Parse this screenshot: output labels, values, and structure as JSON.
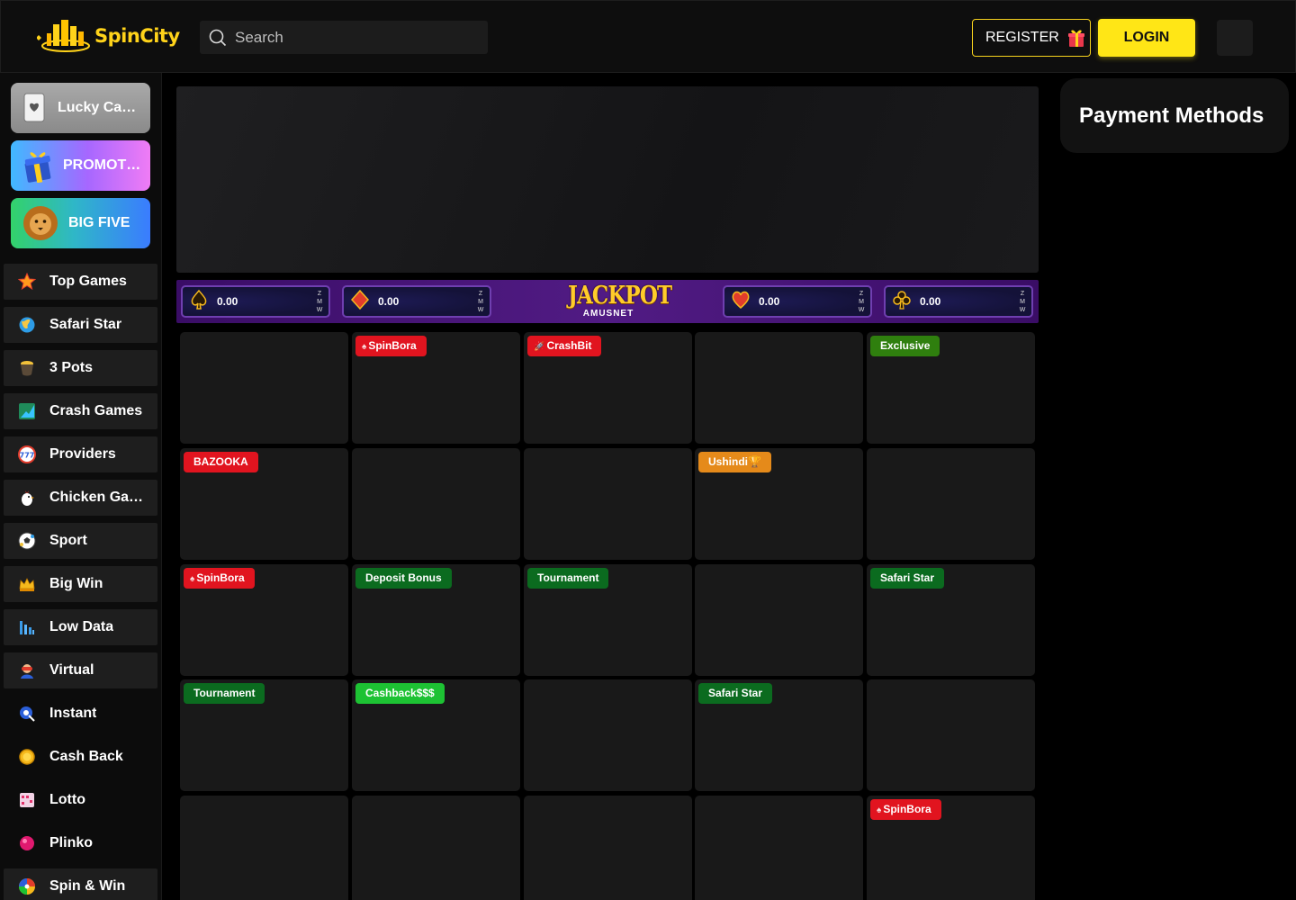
{
  "header": {
    "logo_text": "SpinCity",
    "search_placeholder": "Search",
    "register_label": "REGISTER",
    "login_label": "LOGIN"
  },
  "sidebar": {
    "promos": [
      {
        "label": "Lucky Cards",
        "icon": "card-icon"
      },
      {
        "label": "PROMOTIONS",
        "icon": "gift-icon"
      },
      {
        "label": "BIG FIVE",
        "icon": "lion-icon"
      }
    ],
    "items": [
      {
        "label": "Top Games",
        "icon": "star-icon"
      },
      {
        "label": "Safari Star",
        "icon": "globe-icon"
      },
      {
        "label": "3 Pots",
        "icon": "pot-icon"
      },
      {
        "label": "Crash Games",
        "icon": "crash-chart-icon"
      },
      {
        "label": "Providers",
        "icon": "slot-777-icon"
      },
      {
        "label": "Chicken Games",
        "icon": "chicken-icon"
      },
      {
        "label": "Sport",
        "icon": "soccer-ball-icon"
      },
      {
        "label": "Big Win",
        "icon": "crown-icon"
      },
      {
        "label": "Low Data",
        "icon": "bar-chart-icon"
      },
      {
        "label": "Virtual",
        "icon": "vr-icon"
      },
      {
        "label": "Instant",
        "icon": "instant-icon"
      },
      {
        "label": "Cash Back",
        "icon": "coin-icon"
      },
      {
        "label": "Lotto",
        "icon": "lotto-ticket-icon"
      },
      {
        "label": "Plinko",
        "icon": "plinko-ball-icon"
      },
      {
        "label": "Spin & Win",
        "icon": "wheel-icon"
      }
    ]
  },
  "jackpot": {
    "title": "JACKPOT",
    "provider": "AMUSNET",
    "currency": "ZMW",
    "pots": [
      {
        "suit": "spade",
        "value": "0.00"
      },
      {
        "suit": "diamond",
        "value": "0.00"
      },
      {
        "suit": "heart",
        "value": "0.00"
      },
      {
        "suit": "club",
        "value": "0.00"
      }
    ]
  },
  "tiles": [
    {
      "badge": null
    },
    {
      "badge": "SpinBora",
      "color": "red",
      "icon": "♠"
    },
    {
      "badge": "CrashBit",
      "color": "red",
      "icon": "🚀"
    },
    {
      "badge": null
    },
    {
      "badge": "Exclusive",
      "color": "olive"
    },
    {
      "badge": "BAZOOKA",
      "color": "red"
    },
    {
      "badge": null
    },
    {
      "badge": null
    },
    {
      "badge": "Ushindi🏆",
      "color": "orange"
    },
    {
      "badge": null
    },
    {
      "badge": "SpinBora",
      "color": "red",
      "icon": "♠"
    },
    {
      "badge": "Deposit Bonus",
      "color": "green"
    },
    {
      "badge": "Tournament",
      "color": "green"
    },
    {
      "badge": null
    },
    {
      "badge": "Safari Star",
      "color": "green"
    },
    {
      "badge": "Tournament",
      "color": "green"
    },
    {
      "badge": "Cashback$$$",
      "color": "lime"
    },
    {
      "badge": null
    },
    {
      "badge": "Safari Star",
      "color": "green"
    },
    {
      "badge": null
    },
    {
      "badge": null
    },
    {
      "badge": null
    },
    {
      "badge": null
    },
    {
      "badge": null
    },
    {
      "badge": "SpinBora",
      "color": "red",
      "icon": "♠"
    }
  ],
  "payment": {
    "title": "Payment Methods"
  },
  "colors": {
    "accent": "#ffe616",
    "tile": "#191919",
    "nav": "#1e1e1e"
  }
}
